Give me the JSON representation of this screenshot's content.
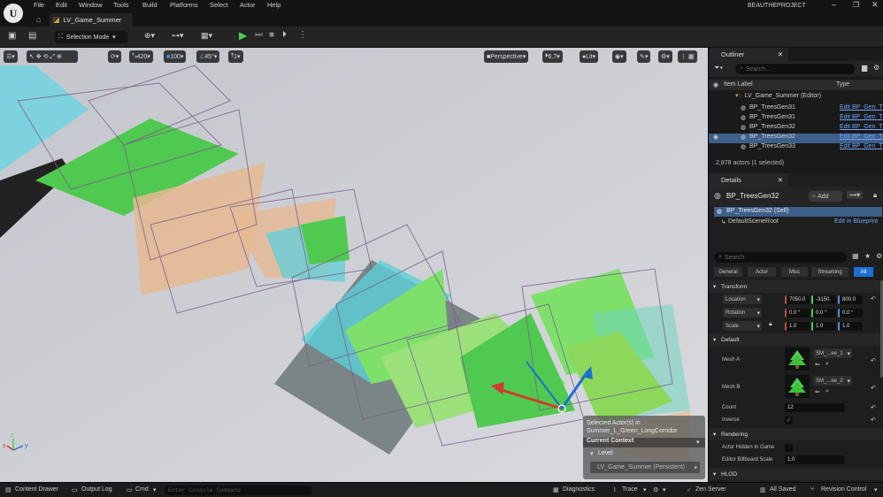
{
  "window": {
    "project": "BEAUTHEPROJECT",
    "map_tab": "LV_Game_Summer"
  },
  "menu": [
    "File",
    "Edit",
    "Window",
    "Tools",
    "Build",
    "Platforms",
    "Select",
    "Actor",
    "Help"
  ],
  "toolbar": {
    "mode": "Selection Mode"
  },
  "viewport": {
    "grid_snap": "420",
    "scale_snap": "100",
    "angle_snap": "45°",
    "camera_speed_index": "1",
    "view_type": "Perspective",
    "camera_speed": "6.7",
    "lighting": "Lit",
    "context": {
      "selected": "Selected Actor(s) in Summer_L_Green_LongCorridor",
      "title": "Current Context",
      "level_label": "Level",
      "level_value": "LV_Game_Summer (Persistent)"
    }
  },
  "outliner": {
    "tab": "Outliner",
    "search_placeholder": "Search...",
    "col_label": "Item Label",
    "col_type": "Type",
    "root": "LV_Game_Summer (Editor)",
    "items": [
      {
        "label": "BP_TreesGen31",
        "type": "Edit BP_Gen_T"
      },
      {
        "label": "BP_TreesGen31",
        "type": "Edit BP_Gen_T"
      },
      {
        "label": "BP_TreesGen32",
        "type": "Edit BP_Gen_T"
      },
      {
        "label": "BP_TreesGen32",
        "type": "Edit BP_Gen_T"
      },
      {
        "label": "BP_TreesGen33",
        "type": "Edit BP_Gen_T"
      }
    ],
    "count": "2,878 actors (1 selected)"
  },
  "details": {
    "tab": "Details",
    "actor": "BP_TreesGen32",
    "add": "Add",
    "self": "BP_TreesGen32 (Self)",
    "component": "DefaultSceneRoot",
    "edit_bp": "Edit in Blueprint",
    "search_placeholder": "Search",
    "filters": [
      "General",
      "Actor",
      "Misc",
      "Streaming",
      "All"
    ],
    "transform": "Transform",
    "location_label": "Location",
    "location": [
      "7050.0",
      "-3150.",
      "800.0"
    ],
    "rotation_label": "Rotation",
    "rotation": [
      "0.0 °",
      "0.0 °",
      "0.0 °"
    ],
    "scale_label": "Scale",
    "scale": [
      "1.0",
      "1.0",
      "1.0"
    ],
    "default": "Default",
    "mesh_a_label": "Mesh A",
    "mesh_a": "SM_...ee_1",
    "mesh_b_label": "Mesh B",
    "mesh_b": "SM_...ee_2",
    "count_label": "Count",
    "count": "12",
    "inverse_label": "Inverse",
    "rendering": "Rendering",
    "hidden_label": "Actor Hidden In Game",
    "billboard_label": "Editor Billboard Scale",
    "billboard": "1.0",
    "hlod": "HLOD"
  },
  "statusbar": {
    "content_drawer": "Content Drawer",
    "output_log": "Output Log",
    "cmd": "Cmd",
    "console_placeholder": "Enter Console Command",
    "diagnostics": "Diagnostics",
    "trace": "Trace",
    "zen": "Zen Server",
    "saved": "All Saved",
    "revision": "Revision Control"
  },
  "colors": {
    "accent_green": "#3dbf3d",
    "selection_blue": "#1d6fd1",
    "link": "#6fa6ff"
  }
}
